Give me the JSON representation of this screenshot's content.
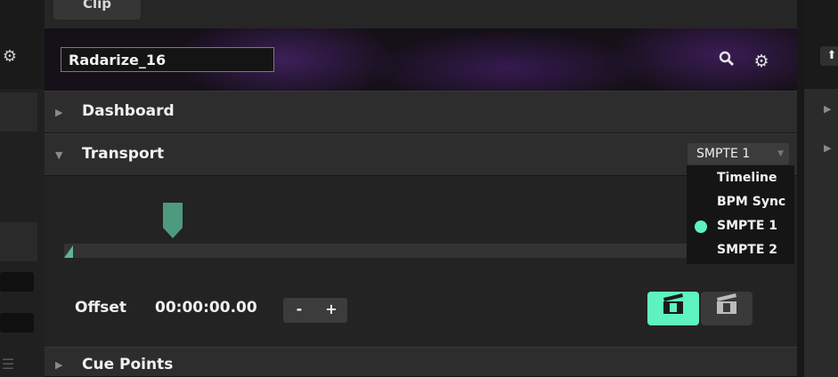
{
  "panel": {
    "tab_label": "Clip",
    "clip_name": "Radarize_16",
    "icons": {
      "search": "search-icon",
      "settings": "gear-icon"
    }
  },
  "sections": {
    "dashboard": {
      "title": "Dashboard",
      "expanded": false
    },
    "transport": {
      "title": "Transport",
      "expanded": true
    },
    "cue_points": {
      "title": "Cue Points",
      "expanded": false
    }
  },
  "transport": {
    "mode_selected": "SMPTE 1",
    "mode_menu": {
      "open": true,
      "items": [
        "Timeline",
        "BPM Sync",
        "SMPTE 1",
        "SMPTE 2"
      ],
      "active_item": "SMPTE 1"
    },
    "offset_label": "Offset",
    "offset_value": "00:00:00.00",
    "decrement_label": "-",
    "increment_label": "+",
    "layer_buttons": [
      {
        "label": "1",
        "active": true
      },
      {
        "label": "2",
        "active": false
      }
    ]
  },
  "colors": {
    "accent": "#5ef2c0",
    "playhead": "#4e9a7e",
    "panel_bg": "#262626",
    "header_purple": "#3d1f5a"
  }
}
